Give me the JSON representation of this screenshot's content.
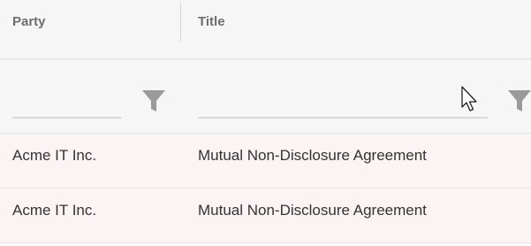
{
  "columns": {
    "party": "Party",
    "title": "Title"
  },
  "filters": {
    "party": {
      "value": "",
      "placeholder": ""
    },
    "title": {
      "value": "",
      "placeholder": ""
    },
    "icon": "filter-icon"
  },
  "rows": [
    {
      "party": "Acme IT Inc.",
      "title": "Mutual Non-Disclosure Agreement"
    },
    {
      "party": "Acme IT Inc.",
      "title": "Mutual Non-Disclosure Agreement"
    }
  ],
  "colors": {
    "header_bg": "#f6f6f6",
    "row_bg": "#fcf4f4",
    "header_text": "#6e6e6e",
    "cell_text": "#333333",
    "icon": "#9a9a9a"
  }
}
